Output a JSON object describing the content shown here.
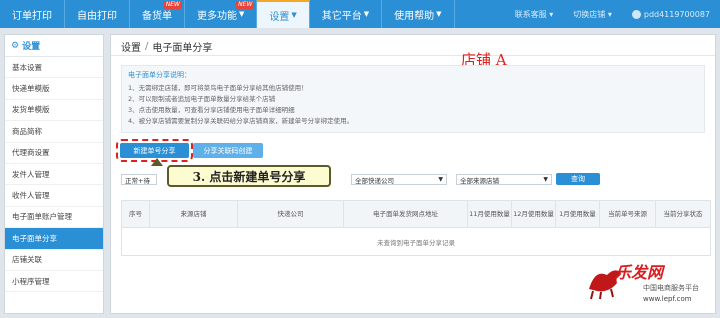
{
  "topnav": {
    "items": [
      {
        "label": "订单打印"
      },
      {
        "label": "自由打印"
      },
      {
        "label": "备货单",
        "badge": "NEW"
      },
      {
        "label": "更多功能",
        "badge": "NEW"
      },
      {
        "label": "设置"
      },
      {
        "label": "其它平台"
      },
      {
        "label": "使用帮助"
      }
    ],
    "contact": "联系客服",
    "switch_shop": "切换店铺",
    "username": "pdd4119700087"
  },
  "sidebar": {
    "title": "设置",
    "items": [
      "基本设置",
      "快递单模版",
      "发货单模版",
      "商品简称",
      "代理商设置",
      "发件人管理",
      "收件人管理",
      "电子面单账户管理",
      "电子面单分享",
      "店铺关联",
      "小程序管理"
    ]
  },
  "breadcrumb": {
    "root": "设置",
    "current": "电子面单分享"
  },
  "annotation_shop": "店铺 A",
  "info": {
    "title": "电子面单分享说明：",
    "lines": [
      "1、无需绑定店铺，即可将菜鸟电子面单分享给其他店铺使用！",
      "2、可以限制或者追加电子面单数量分享给某个店铺",
      "3、点击使用数量，可查看分享店铺使用电子面单详细明细",
      "4、被分享店铺需要复制分享关联码给分享店铺商家，新建单号分享绑定使用。"
    ]
  },
  "buttons": {
    "new_share": "新建单号分享",
    "view_code": "分享关联码创建",
    "query": "查询"
  },
  "callout": "3. 点击新建单号分享",
  "filters": {
    "status": "正常+待",
    "express": "全部快递公司",
    "source": "全部来源店铺"
  },
  "table": {
    "headers": [
      "序号",
      "来源店铺",
      "快递公司",
      "电子面单发货网点地址",
      "11月使用数量",
      "12月使用数量",
      "1月使用数量",
      "当前单号来源",
      "当前分享状态"
    ],
    "empty_text": "未查询到电子面单分享记录"
  },
  "watermark": {
    "brand": "乐发网",
    "sub": "中国电商服务平台",
    "url": "www.lepf.com"
  },
  "colors": {
    "accent": "#2b8fd6",
    "highlight": "#e02020"
  }
}
